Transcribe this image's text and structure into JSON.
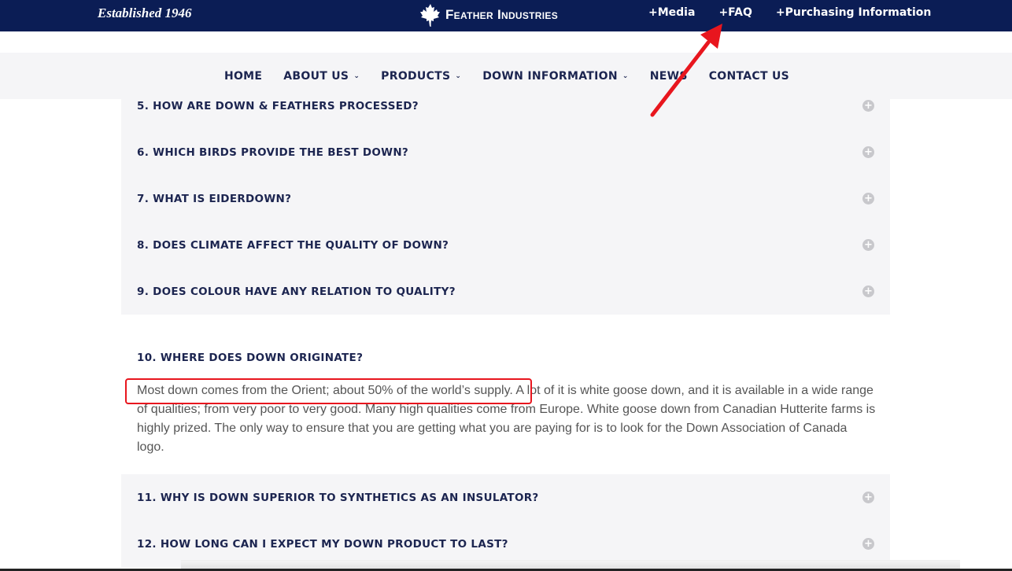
{
  "topbar": {
    "established": "Established 1946",
    "brand": "Feather Industries",
    "links": [
      "+Media",
      "+FAQ",
      "+Purchasing Information"
    ]
  },
  "nav": {
    "items": [
      {
        "label": "HOME",
        "dropdown": false
      },
      {
        "label": "ABOUT US",
        "dropdown": true
      },
      {
        "label": "PRODUCTS",
        "dropdown": true
      },
      {
        "label": "DOWN INFORMATION",
        "dropdown": true
      },
      {
        "label": "NEWS",
        "dropdown": false
      },
      {
        "label": "CONTACT US",
        "dropdown": false
      }
    ]
  },
  "faq": {
    "before": [
      "5. HOW ARE DOWN & FEATHERS PROCESSED?",
      "6. WHICH BIRDS PROVIDE THE BEST DOWN?",
      "7. WHAT IS EIDERDOWN?",
      "8. DOES CLIMATE AFFECT THE QUALITY OF DOWN?",
      "9. DOES COLOUR HAVE ANY RELATION TO QUALITY?"
    ],
    "open": {
      "question": "10. WHERE DOES DOWN ORIGINATE?",
      "answer": "Most down comes from the Orient; about 50% of the world’s supply. A lot of it is white goose down, and it is available in a wide range of qualities; from very poor to very good. Many high qualities come from Europe. White goose down from Canadian Hutterite farms is highly prized. The only way to ensure that you are getting what you are paying for is to look for the Down Association of Canada logo."
    },
    "after": [
      "11. WHY IS DOWN SUPERIOR TO SYNTHETICS AS AN INSULATOR?",
      "12. HOW LONG CAN I EXPECT MY DOWN PRODUCT TO LAST?"
    ]
  },
  "colors": {
    "navy": "#0b1d55",
    "annotation": "#e8161e"
  }
}
